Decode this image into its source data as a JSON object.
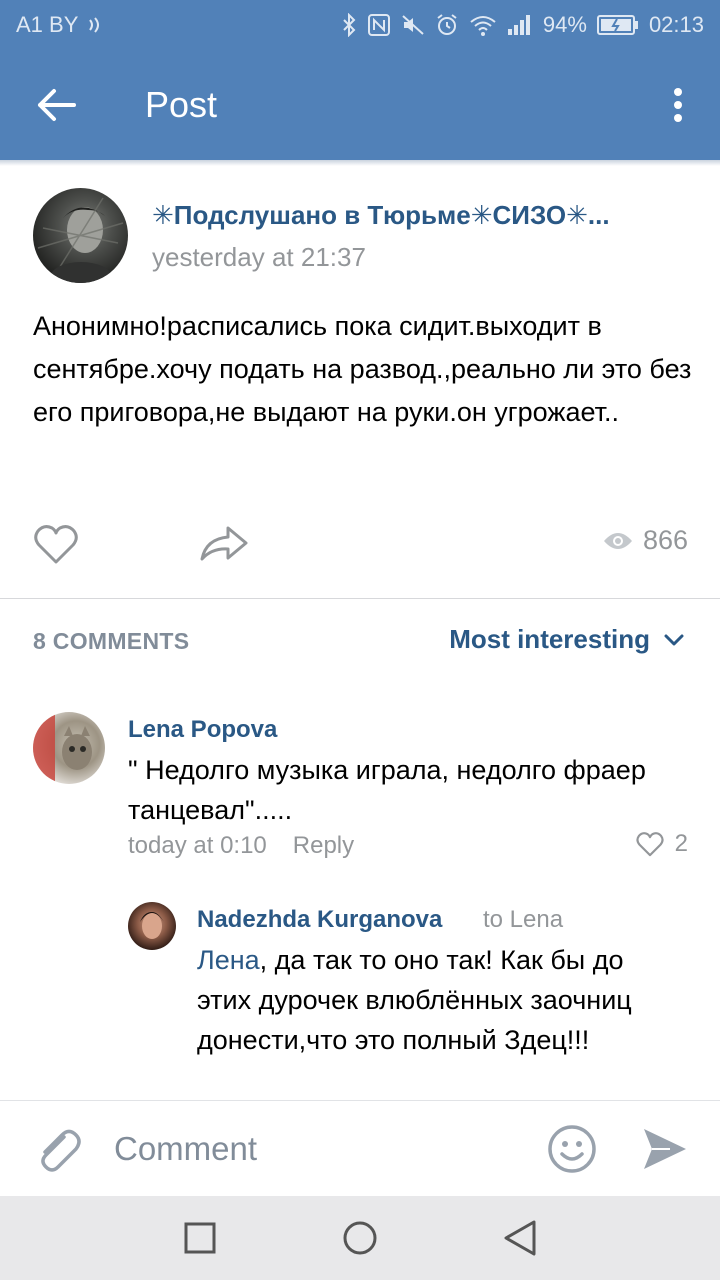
{
  "status_bar": {
    "carrier": "A1 BY",
    "battery": "94%",
    "time": "02:13"
  },
  "app_bar": {
    "title": "Post"
  },
  "post": {
    "author": "✳Подслушано в Тюрьме✳СИЗО✳...",
    "time": "yesterday at 21:37",
    "text": "Анонимно!расписались пока сидит.выходит в сентябре.хочу подать на развод.,реально ли это без его приговора,не выдают на руки.он угрожает..",
    "views": "866"
  },
  "comments_header": {
    "count_label": "8 COMMENTS",
    "sort_label": "Most interesting"
  },
  "comments": [
    {
      "author": "Lena Popova",
      "text": "\" Недолго музыка играла, недолго фраер танцевал\".....",
      "time": "today at 0:10",
      "reply_label": "Reply",
      "likes": "2"
    },
    {
      "author": "Nadezhda Kurganova",
      "to_label": "to Lena",
      "mention": "Лена",
      "text": ", да так то оно так! Как бы до этих дурочек влюблённых заочниц донести,что это полный Здец!!!"
    }
  ],
  "composer": {
    "placeholder": "Comment"
  },
  "colors": {
    "accent": "#5181b8",
    "link": "#2a5885",
    "secondary_text": "#939699"
  }
}
